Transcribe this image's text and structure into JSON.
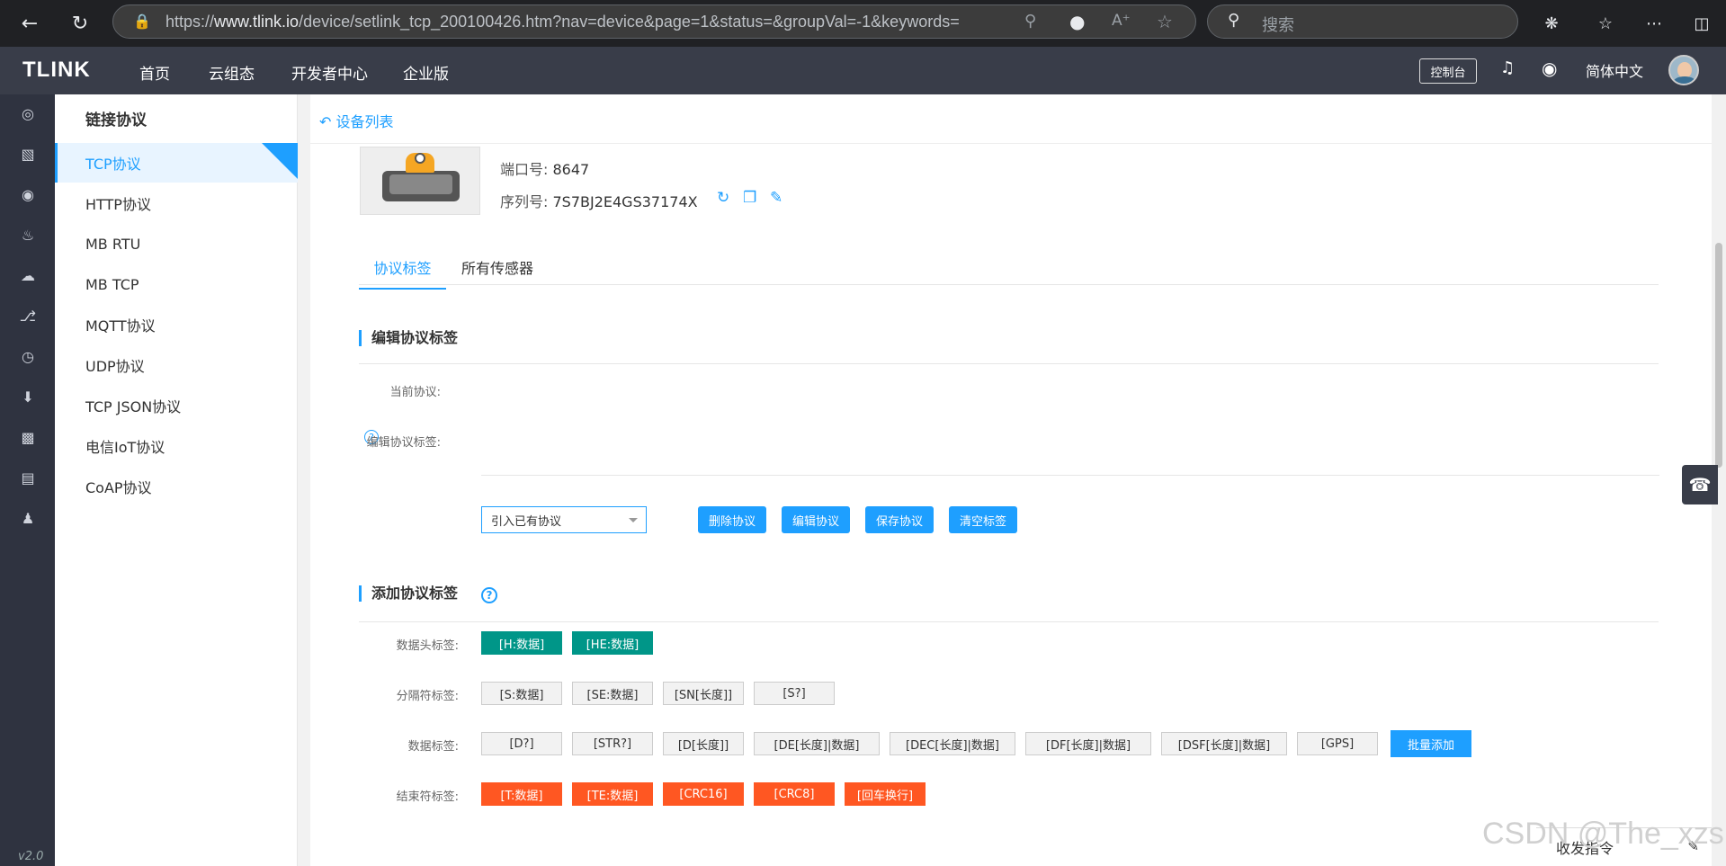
{
  "browser": {
    "url_prefix": "https://",
    "url_host": "www.tlink.io",
    "url_path": "/device/setlink_tcp_200100426.htm?nav=device&page=1&status=&groupVal=-1&keywords=",
    "search_placeholder": "搜索"
  },
  "topnav": {
    "logo": "TLINK",
    "items": [
      "首页",
      "云组态",
      "开发者中心",
      "企业版"
    ],
    "console": "控制台",
    "language": "简体中文"
  },
  "sidebar": {
    "version": "v2.0",
    "icons": [
      "home-icon",
      "device-icon",
      "location-icon",
      "bell-icon",
      "cloud-icon",
      "share-icon",
      "clock-icon",
      "download-icon",
      "monitor-icon",
      "card-icon",
      "user-icon"
    ]
  },
  "subnav": {
    "title": "链接协议",
    "items": [
      "TCP协议",
      "HTTP协议",
      "MB  RTU",
      "MB  TCP",
      "MQTT协议",
      "UDP协议",
      "TCP  JSON协议",
      "电信IoT协议",
      "CoAP协议"
    ],
    "active": "TCP协议"
  },
  "main": {
    "back": "设备列表",
    "port_label": "端口号:",
    "port": "8647",
    "serial_label": "序列号:",
    "serial": "7S7BJ2E4GS37174X",
    "tabs": [
      "协议标签",
      "所有传感器"
    ],
    "edit_section": "编辑协议标签",
    "current_label": "当前协议:",
    "edit_label": "编辑协议标签:",
    "select_value": "引入已有协议",
    "buttons": [
      "删除协议",
      "编辑协议",
      "保存协议",
      "清空标签"
    ],
    "add_section": "添加协议标签",
    "row_labels": [
      "数据头标签:",
      "分隔符标签:",
      "数据标签:",
      "结束符标签:"
    ],
    "head_tags": [
      "[H:数据]",
      "[HE:数据]"
    ],
    "sep_tags": [
      "[S:数据]",
      "[SE:数据]",
      "[SN[长度]]",
      "[S?]"
    ],
    "data_tags": [
      "[D?]",
      "[STR?]",
      "[D[长度]]",
      "[DE[长度]|数据]",
      "[DEC[长度]|数据]",
      "[DF[长度]|数据]",
      "[DSF[长度]|数据]",
      "[GPS]"
    ],
    "batch_add": "批量添加",
    "end_tags": [
      "[T:数据]",
      "[TE:数据]",
      "[CRC16]",
      "[CRC8]",
      "[回车换行]"
    ],
    "cmd_bar": "收发指令",
    "watermark": "CSDN @The_xzs"
  }
}
